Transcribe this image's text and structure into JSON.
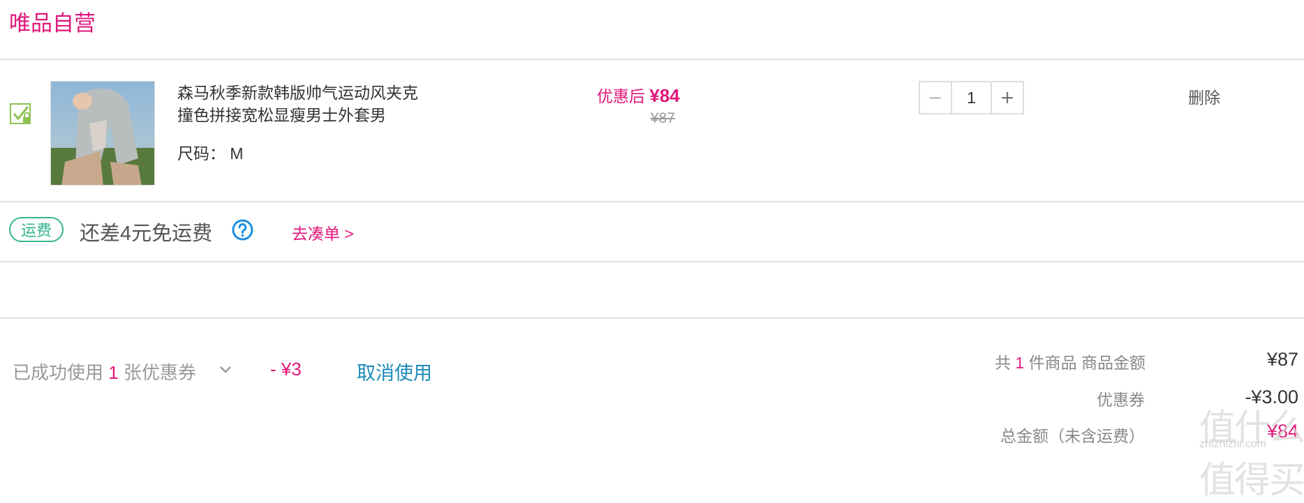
{
  "store": {
    "title": "唯品自营"
  },
  "item": {
    "name_line1": "森马秋季新款韩版帅气运动风夹克",
    "name_line2": "撞色拼接宽松显瘦男士外套男",
    "size": "尺码：  M",
    "discount_label": "优惠后",
    "discount_price": "¥84",
    "original_price": "¥87",
    "quantity": "1",
    "minus_symbol": "−",
    "plus_symbol": "+",
    "delete_label": "删除",
    "checked": true
  },
  "shipping": {
    "badge": "运费",
    "message": "还差4元免运费",
    "link": "去凑单 >"
  },
  "coupon": {
    "prefix": "已成功使用",
    "count": "1",
    "suffix": "张优惠券",
    "amount": "- ¥3",
    "cancel": "取消使用"
  },
  "summary": {
    "count_prefix": "共",
    "count": "1",
    "count_suffix": "件商品  商品金额",
    "goods_amount": "¥87",
    "coupon_label": "优惠券",
    "coupon_amount": "-¥3.00",
    "total_label": "总金额（未含运费）",
    "total_amount": "¥84"
  },
  "watermark": {
    "main": "值什么值得买",
    "sub": "zhizhizhi.com"
  },
  "colors": {
    "accent": "#e0177b",
    "shipping_green": "#33b590",
    "link_blue": "#1b8bb8",
    "divider": "#e2e2e2"
  },
  "icons": [
    "checkbox-locked-icon",
    "help-circle-icon",
    "chevron-down-icon"
  ]
}
